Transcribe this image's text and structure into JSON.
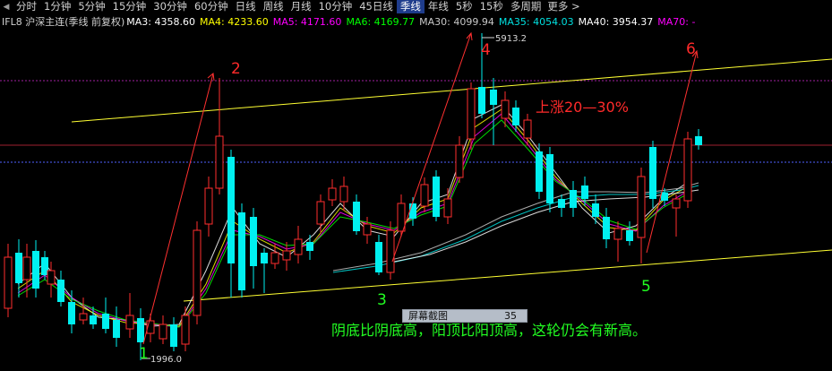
{
  "toolbar": {
    "fold_icon": "triangle-left-icon",
    "periods": [
      "分时",
      "1分钟",
      "5分钟",
      "15分钟",
      "30分钟",
      "60分钟",
      "日线",
      "周线",
      "月线",
      "10分钟",
      "45日线",
      "季线",
      "年线",
      "5秒",
      "15秒",
      "多周期"
    ],
    "active_period": "季线",
    "more": "更多",
    "more_icon": "chevron-right-icon"
  },
  "indicator_row": {
    "symbol": "IFL8 沪深主连(季线 前复权)",
    "mas": [
      {
        "label": "MA3: 4358.60",
        "color": "#ffffff"
      },
      {
        "label": "MA4: 4233.60",
        "color": "#ffff00"
      },
      {
        "label": "MA5: 4171.60",
        "color": "#ff00ff"
      },
      {
        "label": "MA6: 4169.77",
        "color": "#00ff00"
      },
      {
        "label": "MA30: 4099.94",
        "color": "#c8c8c8"
      },
      {
        "label": "MA35: 4054.03",
        "color": "#00e0e0"
      },
      {
        "label": "MA40: 3954.37",
        "color": "#ffffff"
      },
      {
        "label": "MA70: -",
        "color": "#ff00ff"
      }
    ]
  },
  "chart": {
    "high_label": "5913.2",
    "low_label": "1996.0",
    "waves": [
      "1",
      "2",
      "3",
      "4",
      "5",
      "6"
    ],
    "rise_note": "上涨20—30%",
    "summary_note": "阴底比阴底高，阳顶比阳顶高，这轮仍会有新高。"
  },
  "screenshot_bar": {
    "title": "屏幕截图",
    "value": "35"
  },
  "colors": {
    "up": "#ff2e2e",
    "down": "#00f0f0",
    "channel": "#ffff33",
    "accent_red": "#ff2a2a",
    "accent_green": "#22ff22"
  }
}
